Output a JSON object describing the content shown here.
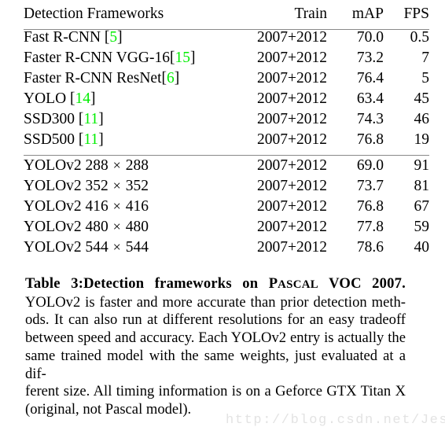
{
  "document": {
    "kind": "paper-table-figure",
    "background_color": "#ffffff",
    "text_color": "#000000",
    "citation_color": "#00ee00",
    "rule_color": "#8a8a8a"
  },
  "table": {
    "columns": [
      {
        "key": "name",
        "header": "Detection Frameworks",
        "align": "left"
      },
      {
        "key": "train",
        "header": "Train",
        "align": "right"
      },
      {
        "key": "map",
        "header": "mAP",
        "align": "right"
      },
      {
        "key": "fps",
        "header": "FPS",
        "align": "right"
      }
    ],
    "groups": [
      {
        "rows": [
          {
            "name_pre": "Fast R-CNN [",
            "cite": "5",
            "name_post": "]",
            "train": "2007+2012",
            "map": "70.0",
            "fps": "0.5",
            "map_bold": false
          },
          {
            "name_pre": "Faster R-CNN VGG-16[",
            "cite": "15",
            "name_post": "]",
            "train": "2007+2012",
            "map": "73.2",
            "fps": "7",
            "map_bold": false
          },
          {
            "name_pre": "Faster R-CNN ResNet[",
            "cite": "6",
            "name_post": "]",
            "train": "2007+2012",
            "map": "76.4",
            "fps": "5",
            "map_bold": false
          },
          {
            "name_pre": "YOLO [",
            "cite": "14",
            "name_post": "]",
            "train": "2007+2012",
            "map": "63.4",
            "fps": "45",
            "map_bold": false
          },
          {
            "name_pre": "SSD300 [",
            "cite": "11",
            "name_post": "]",
            "train": "2007+2012",
            "map": "74.3",
            "fps": "46",
            "map_bold": false
          },
          {
            "name_pre": "SSD500 [",
            "cite": "11",
            "name_post": "]",
            "train": "2007+2012",
            "map": "76.8",
            "fps": "19",
            "map_bold": false
          }
        ]
      },
      {
        "rows": [
          {
            "name_pre": "YOLOv2 288 ",
            "times": "×",
            "name_post": " 288",
            "train": "2007+2012",
            "map": "69.0",
            "fps": "91",
            "map_bold": false
          },
          {
            "name_pre": "YOLOv2 352 ",
            "times": "×",
            "name_post": " 352",
            "train": "2007+2012",
            "map": "73.7",
            "fps": "81",
            "map_bold": false
          },
          {
            "name_pre": "YOLOv2 416 ",
            "times": "×",
            "name_post": " 416",
            "train": "2007+2012",
            "map": "76.8",
            "fps": "67",
            "map_bold": false
          },
          {
            "name_pre": "YOLOv2 480 ",
            "times": "×",
            "name_post": " 480",
            "train": "2007+2012",
            "map": "77.8",
            "fps": "59",
            "map_bold": false
          },
          {
            "name_pre": "YOLOv2 544 ",
            "times": "×",
            "name_post": " 544",
            "train": "2007+2012",
            "map": "78.6",
            "fps": "40",
            "map_bold": true
          }
        ]
      }
    ]
  },
  "caption": {
    "label": "Table 3:",
    "title_part1": "Detection frameworks on ",
    "title_smallcaps_first": "P",
    "title_smallcaps_rest": "ASCAL",
    "title_part2": " VOC 2007.",
    "body_lines": [
      "YOLOv2 is faster and more accurate than prior detection meth-",
      "ods. It can also run at different resolutions for an easy tradeoff",
      "between speed and accuracy. Each YOLOv2 entry is actually the",
      "same trained model with the same weights, just evaluated at a dif-",
      "ferent size. All timing information is on a Geforce GTX Titan X",
      "(original, not Pascal model)."
    ]
  },
  "watermark": {
    "text": "http://blog.csdn.net/Jesse_Mx",
    "color": "#e3e3e3"
  }
}
